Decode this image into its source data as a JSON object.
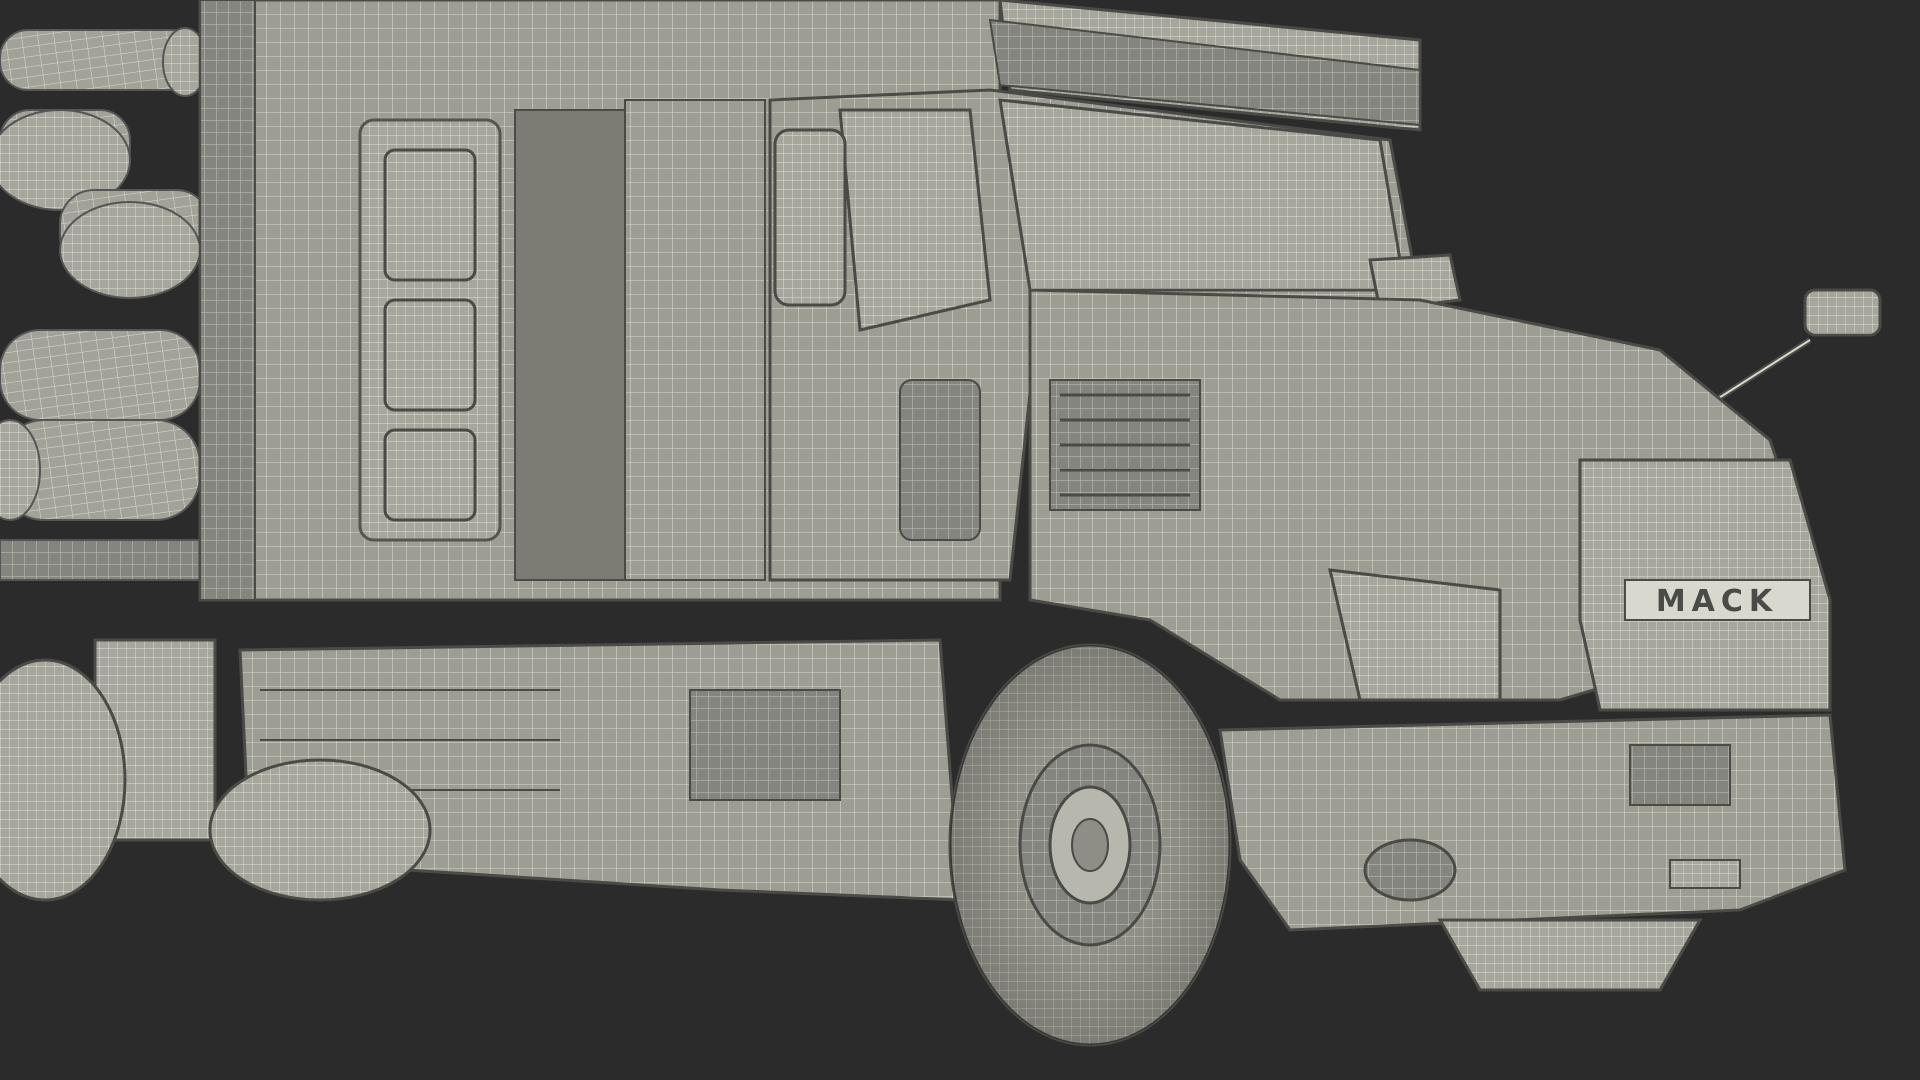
{
  "scene": {
    "background": "#2b2b2b",
    "surface_color": "#9d9d93",
    "surface_light": "#b0b0a6",
    "surface_dark": "#7e7e76",
    "wire_color": "#ecece2",
    "subject": "wireframe-truck-with-logs"
  },
  "grille": {
    "brand_text": "MACK"
  }
}
